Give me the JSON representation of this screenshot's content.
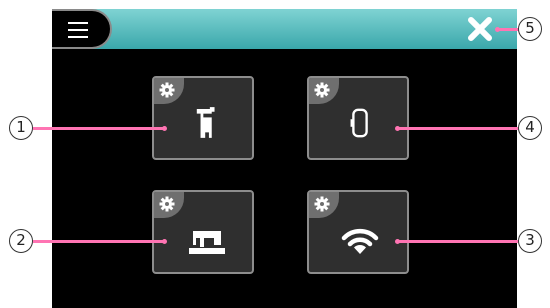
{
  "callouts": {
    "c1": "1",
    "c2": "2",
    "c3": "3",
    "c4": "4",
    "c5": "5"
  },
  "icons": {
    "menu": "hamburger-menu-icon",
    "close": "close-icon",
    "tile_settings": "gear-icon",
    "tile1": "presser-foot-icon",
    "tile2": "sewing-machine-icon",
    "tile3": "wifi-icon",
    "tile4": "embroidery-frame-icon"
  },
  "colors": {
    "topbar_gradient_top": "#7fd3d3",
    "topbar_gradient_bottom": "#3aa7ab",
    "callout_line": "#ff74b3",
    "tile_background": "#2f2f2f",
    "tile_border": "#8d8d8d"
  }
}
